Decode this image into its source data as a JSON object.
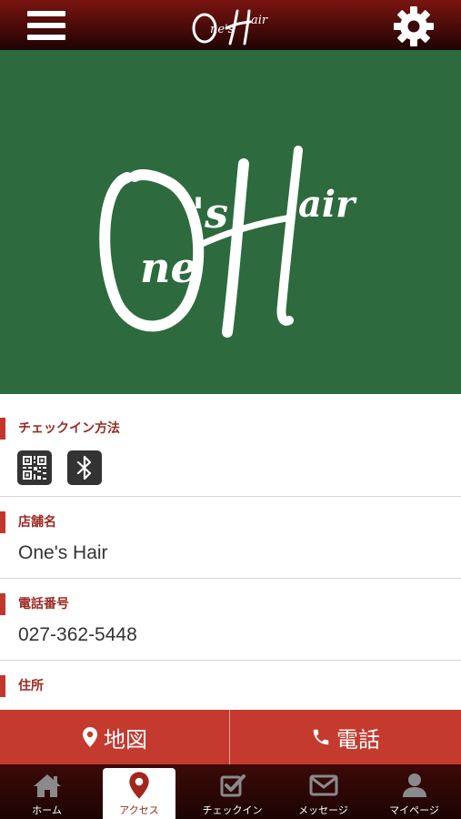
{
  "header": {
    "logo_text": "One's Hair"
  },
  "hero": {
    "logo_text": "One's Hair",
    "background_color": "#2d6a3e"
  },
  "sections": {
    "checkin": {
      "label": "チェックイン方法",
      "methods": [
        "qr-code-icon",
        "bluetooth-icon"
      ]
    },
    "store": {
      "label": "店舗名",
      "value": "One's Hair"
    },
    "phone": {
      "label": "電話番号",
      "value": "027-362-5448"
    },
    "address": {
      "label": "住所"
    }
  },
  "actions": {
    "map_label": "地図",
    "tel_label": "電話"
  },
  "tabs": [
    {
      "label": "ホーム",
      "icon": "home-icon",
      "active": false
    },
    {
      "label": "アクセス",
      "icon": "map-pin-icon",
      "active": true
    },
    {
      "label": "チェックイン",
      "icon": "checkin-icon",
      "active": false
    },
    {
      "label": "メッセージ",
      "icon": "mail-icon",
      "active": false
    },
    {
      "label": "マイページ",
      "icon": "user-icon",
      "active": false
    }
  ],
  "colors": {
    "brand_red": "#c53a2e",
    "header_dark": "#3b0907",
    "hero_green": "#2d6a3e",
    "label_red": "#9b2a22"
  }
}
